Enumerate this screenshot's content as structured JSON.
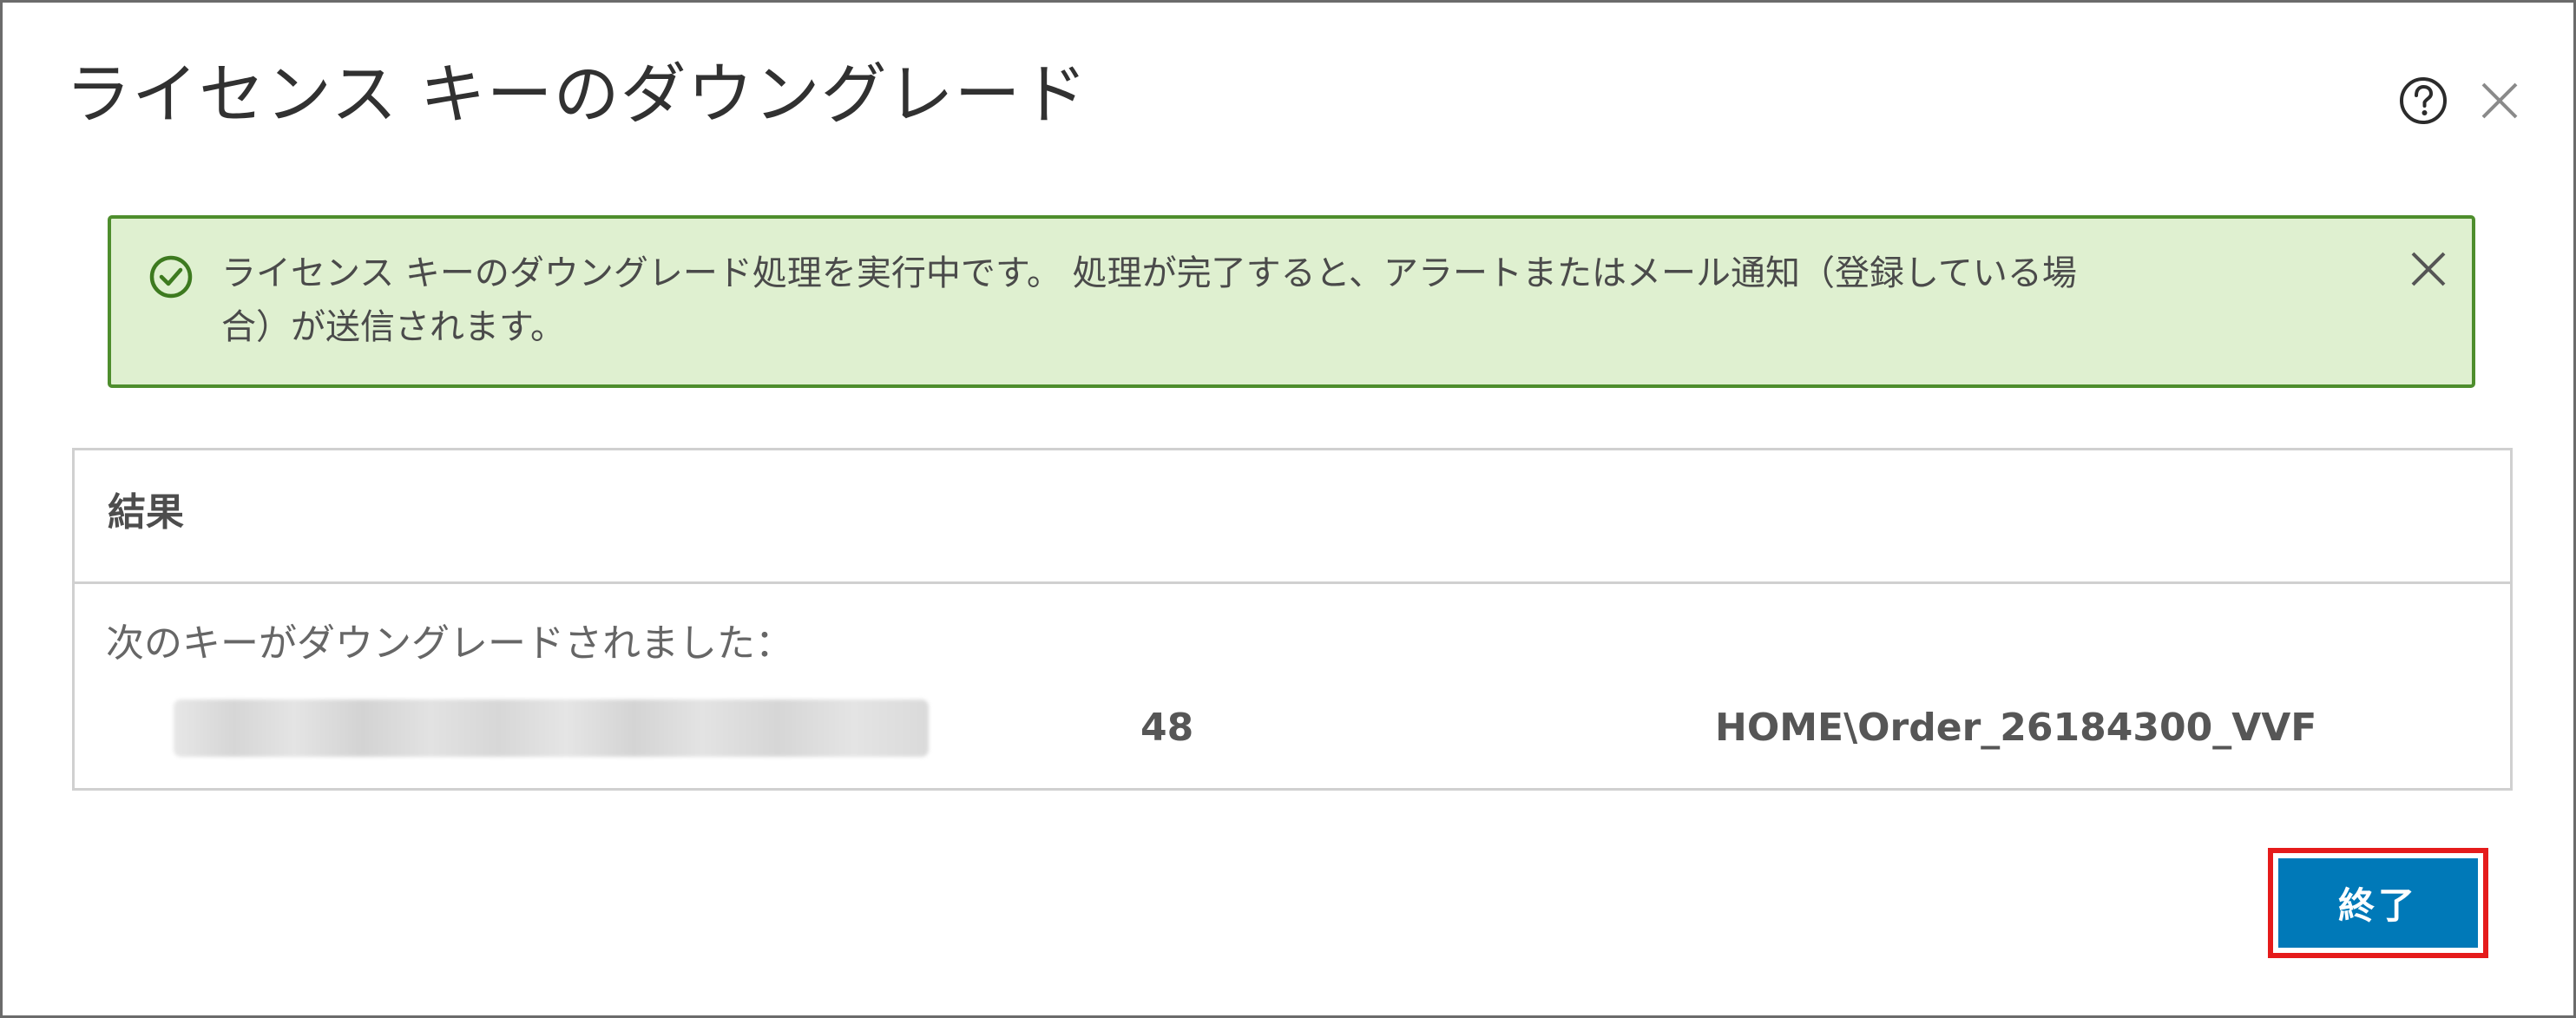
{
  "dialog": {
    "title": "ライセンス キーのダウングレード",
    "icons": {
      "help": "help-circle-icon",
      "close": "close-icon"
    }
  },
  "alert": {
    "status": "success",
    "icon": "check-circle-icon",
    "line1": "ライセンス キーのダウングレード処理を実行中です。 処理が完了すると、アラートまたはメール通知（登録している場",
    "line2": "合）が送信されます。",
    "close_icon": "close-icon",
    "colors": {
      "background": "#dff0d0",
      "border": "#4e8e2d"
    }
  },
  "result": {
    "heading": "結果",
    "message": "次のキーがダウングレードされました：",
    "key": {
      "count": "48",
      "order": "HOME\\Order_26184300_VVF"
    }
  },
  "footer": {
    "finish_label": "終了",
    "colors": {
      "button": "#0079b8",
      "highlight": "#e51b1b"
    }
  }
}
